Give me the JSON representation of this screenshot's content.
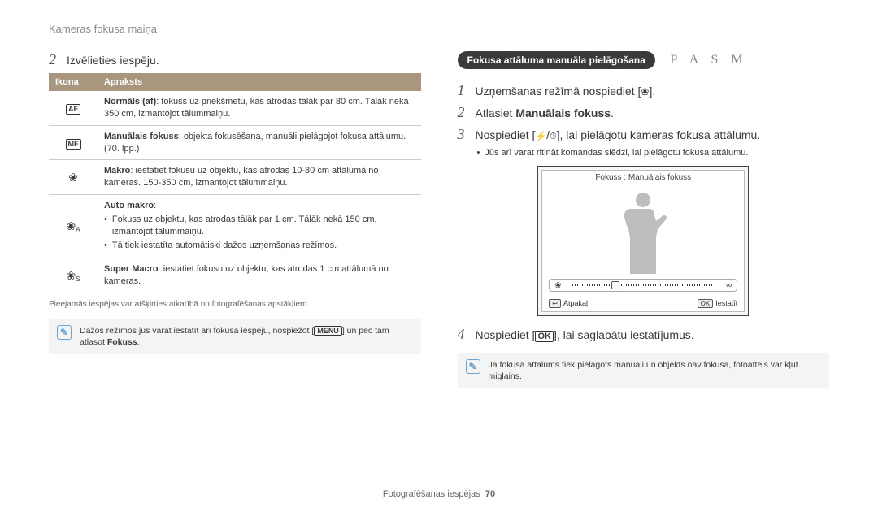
{
  "header": {
    "title": "Kameras fokusa maiņa"
  },
  "left": {
    "step2_num": "2",
    "step2_text": "Izvēlieties iespēju.",
    "table": {
      "th_icon": "Ikona",
      "th_desc": "Apraksts",
      "rows": [
        {
          "icon_type": "af",
          "title": "Normāls (af)",
          "body": ": fokuss uz priekšmetu, kas atrodas tālāk par 80 cm. Tālāk nekā 350 cm, izmantojot tālummaiņu."
        },
        {
          "icon_type": "mf",
          "title": "Manuālais fokuss",
          "body": ": objekta fokusēšana, manuāli pielāgojot fokusa attālumu. (70. lpp.)"
        },
        {
          "icon_type": "macro",
          "title": "Makro",
          "body": ": iestatiet fokusu uz objektu, kas atrodas 10-80 cm attālumā no kameras. 150-350 cm, izmantojot tālummaiņu."
        },
        {
          "icon_type": "amacro",
          "title": "Auto makro",
          "body": "",
          "bullets": [
            "Fokuss uz objektu, kas atrodas tālāk par 1 cm. Tālāk nekā 150 cm, izmantojot tālummaiņu.",
            "Tā tiek iestatīta automātiski dažos uzņemšanas režīmos."
          ]
        },
        {
          "icon_type": "smacro",
          "title": "Super Macro",
          "body": ": iestatiet fokusu uz objektu, kas atrodas 1 cm attālumā no kameras."
        }
      ]
    },
    "footnote": "Pieejamās iespējas var atšķirties atkarībā no fotografēšanas apstākļiem.",
    "note_a": "Dažos režīmos jūs varat iestatīt arī fokusa iespēju, nospiežot [",
    "note_menu": "MENU",
    "note_b": "] un pēc tam atlasot ",
    "note_bold": "Fokuss",
    "note_c": "."
  },
  "right": {
    "pill": "Fokusa attāluma manuāla pielāgošana",
    "modes": "P A S M",
    "steps": {
      "s1_num": "1",
      "s1_a": "Uzņemšanas režīmā nospiediet [",
      "s1_b": "].",
      "s2_num": "2",
      "s2_a": "Atlasiet ",
      "s2_bold": "Manuālais fokuss",
      "s2_b": ".",
      "s3_num": "3",
      "s3_a": "Nospiediet [",
      "s3_b": "/",
      "s3_c": "], lai pielāgotu kameras fokusa attālumu.",
      "s3_sub": "Jūs arī varat ritināt komandas slēdzi, lai pielāgotu fokusa attālumu.",
      "s4_num": "4",
      "s4_a": "Nospiediet [",
      "s4_ok": "OK",
      "s4_b": "], lai saglabātu iestatījumus."
    },
    "screen": {
      "title": "Fokuss : Manuālais fokuss",
      "left_sym": "❀",
      "right_sym": "∞",
      "back_key": "↩",
      "back": "Atpakaļ",
      "set_key": "OK",
      "set": "Iestatīt"
    },
    "note2": "Ja fokusa attālums tiek pielāgots manuāli un objekts nav fokusā, fotoattēls var kļūt miglains."
  },
  "footer": {
    "section": "Fotografēšanas iespējas",
    "page": "70"
  }
}
